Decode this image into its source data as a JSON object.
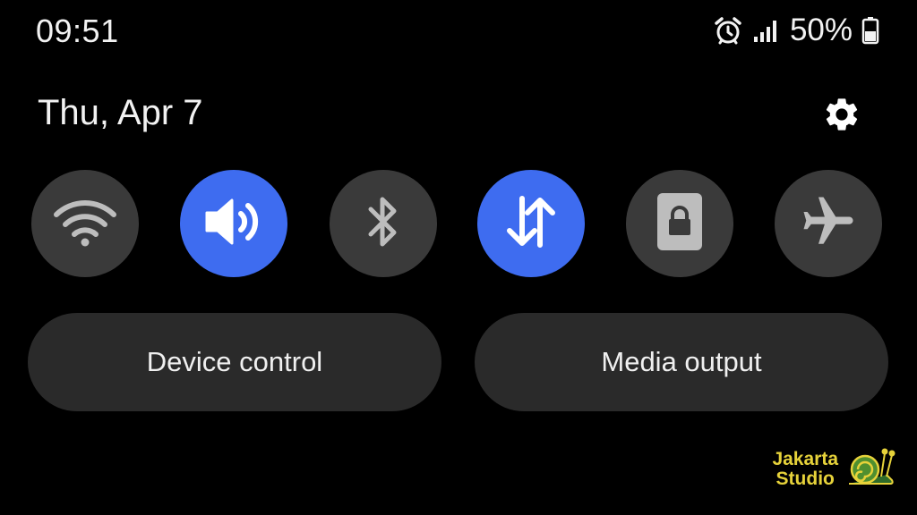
{
  "status_bar": {
    "time": "09:51",
    "battery_percent": "50%",
    "icons": [
      "alarm-icon",
      "signal-icon",
      "battery-icon"
    ]
  },
  "header": {
    "date": "Thu, Apr 7",
    "settings_icon": "gear-icon"
  },
  "quick_toggles": [
    {
      "name": "wifi",
      "icon": "wifi-icon",
      "state": "off"
    },
    {
      "name": "sound",
      "icon": "volume-icon",
      "state": "on"
    },
    {
      "name": "bluetooth",
      "icon": "bluetooth-icon",
      "state": "off"
    },
    {
      "name": "mobile-data",
      "icon": "data-transfer-icon",
      "state": "on"
    },
    {
      "name": "secure-folder",
      "icon": "lock-icon",
      "state": "off"
    },
    {
      "name": "airplane-mode",
      "icon": "airplane-icon",
      "state": "off"
    }
  ],
  "actions": {
    "device_control": "Device control",
    "media_output": "Media output"
  },
  "watermark": {
    "line1": "Jakarta",
    "line2": "Studio"
  },
  "colors": {
    "background": "#000000",
    "toggle_on": "#3e6cf0",
    "toggle_off": "#3a3a3a",
    "pill": "#2a2a2a",
    "icon_off": "#bdbdbd",
    "watermark": "#e6d23a"
  }
}
